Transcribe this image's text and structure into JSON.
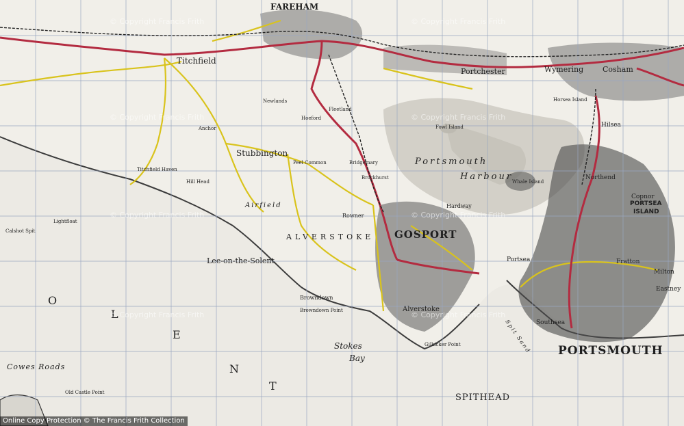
{
  "labels": {
    "fareham": "FAREHAM",
    "titchfield": "Titchfield",
    "stubbington": "Stubbington",
    "portchester": "Portchester",
    "wymering": "Wymering",
    "cosham": "Cosham",
    "gosport": "GOSPORT",
    "portsmouth": "PORTSMOUTH",
    "portsmouth_harbour_1": "Portsmouth",
    "portsmouth_harbour_2": "Harbour",
    "lee_on_the_solent": "Lee-on-the-Solent",
    "alverstoke_area": "ALVERSTOKE",
    "alverstoke": "Alverstoke",
    "the_solent": "THE SOLENT",
    "solent_letters": [
      "O",
      "L",
      "E",
      "N",
      "T"
    ],
    "stokes": "Stokes",
    "bay": "Bay",
    "spithead": "SPITHEAD",
    "cowes_roads": "Cowes Roads",
    "portsea_island_1": "PORTSEA",
    "portsea_island_2": "ISLAND",
    "copnor": "Copnor",
    "northend": "Northend",
    "hilsea": "Hilsea",
    "fratton": "Fratton",
    "milton": "Milton",
    "eastney": "Eastney",
    "southsea": "Southsea",
    "portsea": "Portsea",
    "airfield": "Airfield",
    "rowner": "Rowner",
    "hardway": "Hardway",
    "browndown": "Browndown",
    "browndown_point": "Browndown Point",
    "gilkicker_point": "Gilkicker Point",
    "whale_island": "Whale Island",
    "fowl_island": "Fowl Island",
    "horsea_island": "Horsea Island",
    "calshot_spit": "Calshot Spit",
    "peel_common": "Peel Common",
    "hill_head": "Hill Head",
    "titchfield_haven": "Titchfield Haven",
    "brockhurst": "Brockhurst",
    "bridgemary": "Bridgemary",
    "fleetland": "Fleetland",
    "hoeford": "Hoeford",
    "newlands": "Newlands",
    "anchor": "Anchor",
    "spit_sand": "Spit Sand",
    "old_castle_point": "Old Castle Point",
    "lightfloat": "Lightfloat"
  },
  "watermarks": [
    "© Copyright Francis Frith",
    "© Copyright Francis Frith",
    "© Copyright Francis Frith",
    "© Copyright Francis Frith",
    "© Copyright Francis Frith",
    "© Copyright Francis Frith",
    "© Copyright Francis Frith",
    "© Copyright Francis Frith"
  ],
  "footer": "Online Copy Protection   © The Francis Frith Collection",
  "colors": {
    "land": "#f1efe9",
    "sea_tint": "#ecebe6",
    "grid": "#9aa7c0",
    "main_road": "#b32b40",
    "secondary_road": "#d9c31c",
    "urban": "#3f3f3f",
    "railway": "#222222",
    "marsh": "#d0cec6"
  }
}
